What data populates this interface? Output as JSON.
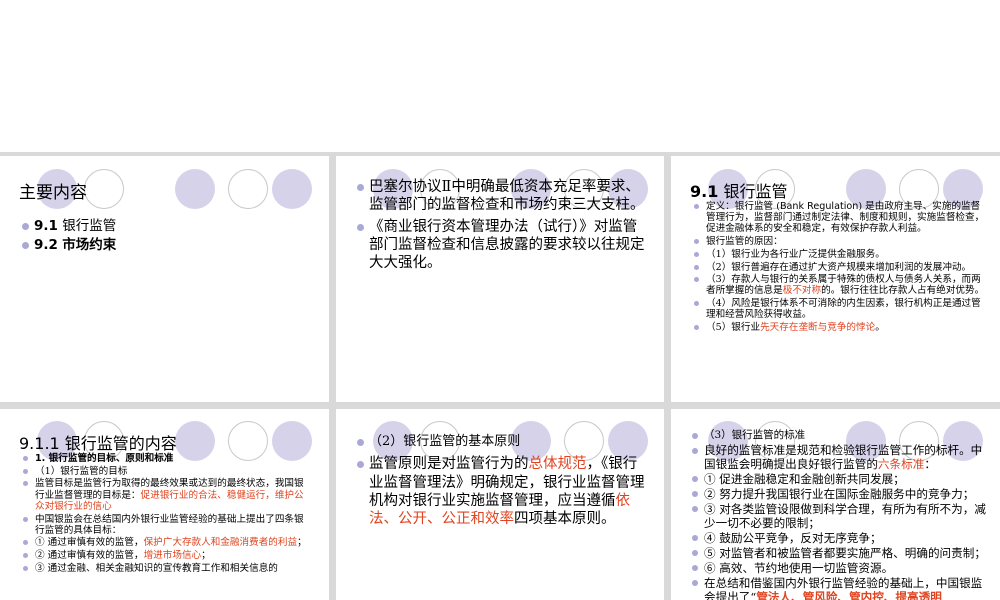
{
  "slides": {
    "s1": {
      "title": "主要内容",
      "items": [
        {
          "num": "9.1",
          "label": "银行监管"
        },
        {
          "num": "9.2",
          "label": "市场约束"
        }
      ]
    },
    "s2": {
      "items": [
        "巴塞尔协议Ⅱ中明确最低资本充足率要求、监管部门的监督检查和市场约束三大支柱。",
        "《商业银行资本管理办法（试行）》对监管部门监督检查和信息披露的要求较以往规定大大强化。"
      ]
    },
    "s3": {
      "title_num": "9.1",
      "title_text": "银行监管",
      "def_prefix": "定义：银行监管 (",
      "def_term": "Bank Regulation",
      "def_rest": ") 是由政府主导、实施的监督管理行为，监督部门通过制定法律、制度和规则，实施监督检查，促进金融体系的安全和稳定，有效保护存款人利益。",
      "reason_title": "银行监管的原因：",
      "r1": "（1）银行业为各行业广泛提供金融服务。",
      "r2": "（2）银行普遍存在通过扩大资产规模来增加利润的发展冲动。",
      "r3_a": "（3）存款人与银行的关系属于特殊的债权人与债务人关系，而两者所掌握的信息是",
      "r3_red": "极不对称",
      "r3_b": "的。银行往往比存款人占有绝对优势。",
      "r4": "（4）风险是银行体系不可消除的内生因素，银行机构正是通过管理和经营风险获得收益。",
      "r5_a": "（5）银行业",
      "r5_red": "先天存在垄断与竞争的悖论",
      "r5_b": "。"
    },
    "s4": {
      "title": "9.1.1 银行监管的内容",
      "h1": "1. 银行监管的目标、原则和标准",
      "sub1": "（1）银行监管的目标",
      "p1_a": "监管目标是监管行为取得的最终效果或达到的最终状态，我国银行业监督管理的目标是：",
      "p1_red": "促进银行业的合法、稳健运行，维护公众对银行业的信心",
      "p2": "中国银监会在总结国内外银行业监管经验的基础上提出了四条银行监管的具体目标：",
      "g1_a": "① 通过审慎有效的监管，",
      "g1_red": "保护广大存款人和金融消费者的利益",
      "g1_b": "；",
      "g2_a": "② 通过审慎有效的监管，",
      "g2_red": "增进市场信心",
      "g2_b": "；",
      "g3": "③ 通过金融、相关金融知识的宣传教育工作和相关信息的"
    },
    "s5": {
      "item1": "（2）银行监管的基本原则",
      "p_a": "监管原则是对监管行为的",
      "p_red1": "总体规范",
      "p_b": "，《银行业监督管理法》明确规定，银行业监督管理机构对银行业实施监督管理，应当遵循",
      "p_red2": "依法、公开、公正和效率",
      "p_c": "四项基本原则。"
    },
    "s6": {
      "item1": "（3）银行监管的标准",
      "p1_a": "良好的监管标准是规范和检验银行监管工作的标杆。中国银监会明确提出良好银行监管的",
      "p1_red": "六条标准",
      "p1_b": "：",
      "std": [
        "① 促进金融稳定和金融创新共同发展；",
        "② 努力提升我国银行业在国际金融服务中的竞争力；",
        "③ 对各类监管设限做到科学合理，有所为有所不为，减少一切不必要的限制；",
        "④ 鼓励公平竞争，反对无序竞争；",
        "⑤ 对监管者和被监管者都要实施严格、明确的问责制；",
        "⑥ 高效、节约地使用一切监管资源。"
      ],
      "p2_a": "在总结和借鉴国内外银行监管经验的基础上，中国银监会提出了“",
      "p2_red": "管法人、管风险、管内控、提高透明"
    }
  }
}
